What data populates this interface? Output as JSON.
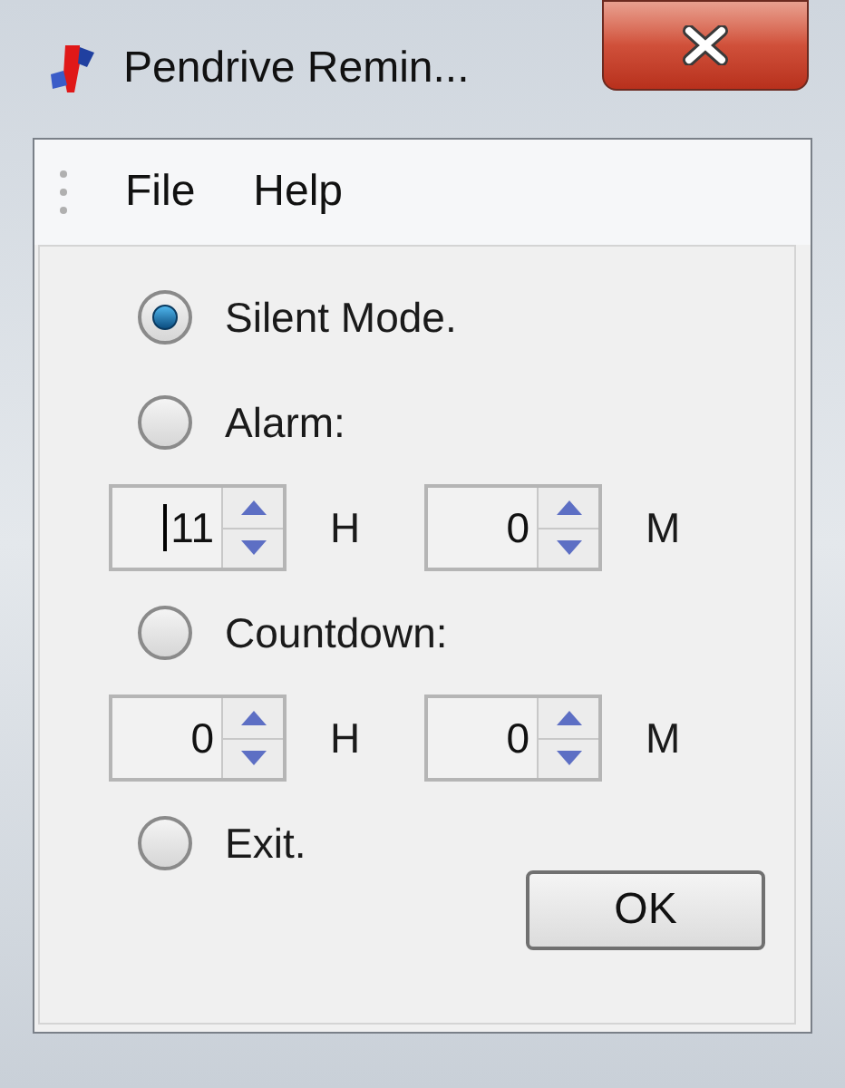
{
  "window": {
    "title": "Pendrive Remin..."
  },
  "menu": [
    "File",
    "Help"
  ],
  "rows": [
    {
      "kind": "radio",
      "label": "Silent Mode.",
      "selected": true
    },
    {
      "kind": "radio",
      "label": "Alarm:",
      "selected": false
    },
    {
      "kind": "time",
      "fields": [
        {
          "value": "11",
          "unit": "H",
          "focused": true
        },
        {
          "value": "0",
          "unit": "M",
          "focused": false
        }
      ]
    },
    {
      "kind": "radio",
      "label": "Countdown:",
      "selected": false
    },
    {
      "kind": "time",
      "fields": [
        {
          "value": "0",
          "unit": "H",
          "focused": false
        },
        {
          "value": "0",
          "unit": "M",
          "focused": false
        }
      ]
    },
    {
      "kind": "radio",
      "label": "Exit.",
      "selected": false
    }
  ],
  "buttons": [
    "OK"
  ]
}
